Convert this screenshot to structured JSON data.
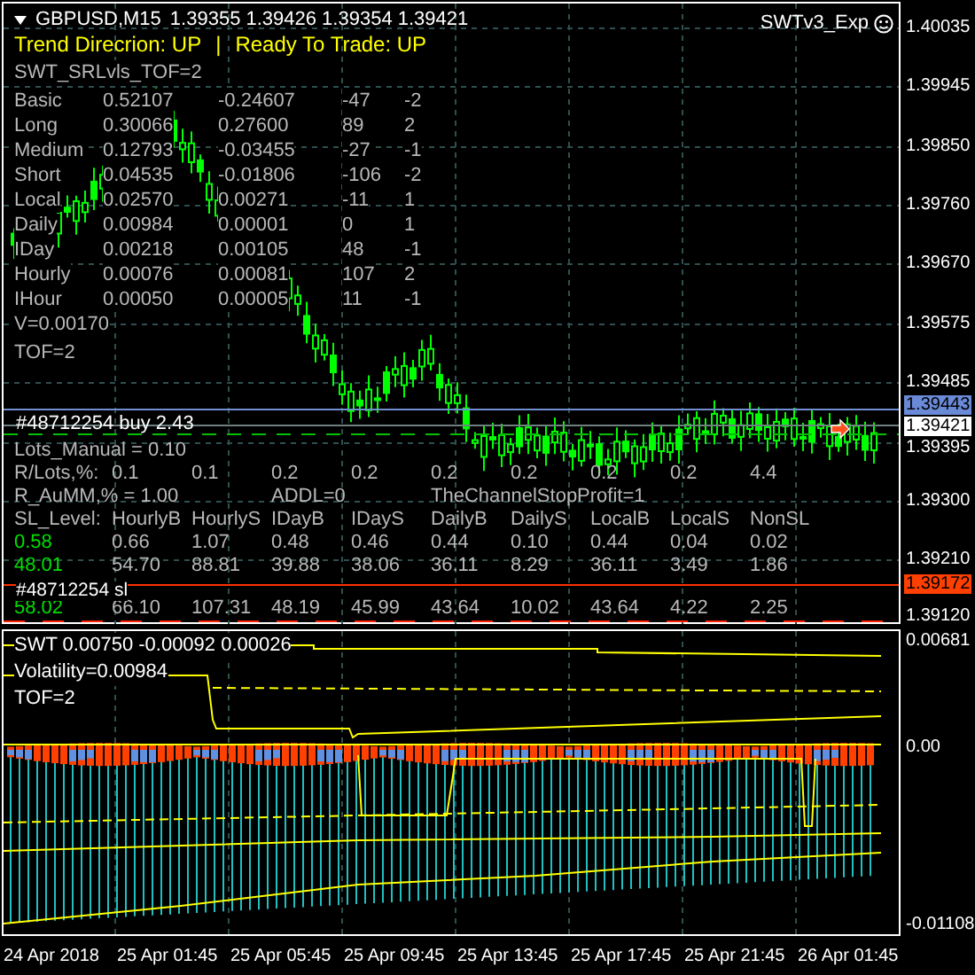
{
  "header": {
    "symbol": "GBPUSD,M15",
    "ohlc": "1.39355 1.39426 1.39354 1.39421"
  },
  "trend": {
    "direction": "Trend Direcrion:  UP",
    "separator": "|",
    "ready": "Ready To Trade:  UP"
  },
  "expert": {
    "name": "SWTv3_Exp"
  },
  "levels": {
    "title": "SWT_SRLvls_TOF=2",
    "rows": [
      [
        "Basic",
        "0.52107",
        "-0.24607",
        "-47",
        "-2"
      ],
      [
        "Long",
        "0.30066",
        "0.27600",
        "89",
        "2"
      ],
      [
        "Medium",
        "0.12793",
        "-0.03455",
        "-27",
        "-1"
      ],
      [
        "Short",
        "0.04535",
        "-0.01806",
        "-106",
        "-2"
      ],
      [
        "Local",
        "0.02570",
        "0.00271",
        "-11",
        "1"
      ],
      [
        "Daily",
        "0.00984",
        "0.00001",
        "0",
        "1"
      ],
      [
        "IDay",
        "0.00218",
        "0.00105",
        "48",
        "-1"
      ],
      [
        "Hourly",
        "0.00076",
        "0.00081",
        "107",
        "2"
      ],
      [
        "IHour",
        "0.00050",
        "0.00005",
        "11",
        "-1"
      ]
    ],
    "volume": "V=0.00170",
    "tof": "TOF=2"
  },
  "order": {
    "label": "#48712254 buy 2.43",
    "sl_label": "#48712254 sl"
  },
  "trade": {
    "lots": "Lots_Manual = 0.10",
    "risk_label": "R/Lots,%:",
    "risk": [
      "0.1",
      "0.1",
      "0.2",
      "0.2",
      "0.2",
      "0.2",
      "0.2",
      "0.2",
      "4.4"
    ],
    "aumm": "R_AuMM,% = 1.00",
    "addl": "ADDL=0",
    "stop_profit": "TheChannelStopProfit=1",
    "sl_header": [
      "SL_Level:",
      "HourlyB",
      "HourlyS",
      "IDayB",
      "IDayS",
      "DailyB",
      "DailyS",
      "LocalB",
      "LocalS",
      "NonSL"
    ],
    "sl_rows": [
      [
        "0.58",
        "0.66",
        "1.07",
        "0.48",
        "0.46",
        "0.44",
        "0.10",
        "0.44",
        "0.04",
        "0.02"
      ],
      [
        "48.01",
        "54.70",
        "88.81",
        "39.88",
        "38.06",
        "36.11",
        "8.29",
        "36.11",
        "3.49",
        "1.86"
      ],
      [
        "58.02",
        "66.10",
        "107.31",
        "48.19",
        "45.99",
        "43.64",
        "10.02",
        "43.64",
        "4.22",
        "2.25"
      ]
    ]
  },
  "price_axis": [
    {
      "label": "1.40035",
      "kind": "grid"
    },
    {
      "label": "1.39945",
      "kind": "grid"
    },
    {
      "label": "1.39850",
      "kind": "grid"
    },
    {
      "label": "1.39760",
      "kind": "grid"
    },
    {
      "label": "1.39670",
      "kind": "grid"
    },
    {
      "label": "1.39575",
      "kind": "grid"
    },
    {
      "label": "1.39485",
      "kind": "grid"
    },
    {
      "label": "1.39443",
      "kind": "order"
    },
    {
      "label": "1.39421",
      "kind": "bid"
    },
    {
      "label": "1.39395",
      "kind": "grid"
    },
    {
      "label": "1.39300",
      "kind": "grid"
    },
    {
      "label": "1.39210",
      "kind": "grid"
    },
    {
      "label": "1.39172",
      "kind": "stop"
    },
    {
      "label": "1.39120",
      "kind": "grid"
    }
  ],
  "indicator": {
    "values": "SWT  0.00750 -0.00092 0.00026",
    "volatility": "Volatility=0.00984",
    "tof": "TOF=2",
    "axis": [
      "0.00681",
      "0.00",
      "-0.01108"
    ]
  },
  "time_axis": [
    "24 Apr 2018",
    "25 Apr 01:45",
    "25 Apr 05:45",
    "25 Apr 09:45",
    "25 Apr 13:45",
    "25 Apr 17:45",
    "25 Apr 21:45",
    "26 Apr 01:45"
  ]
}
